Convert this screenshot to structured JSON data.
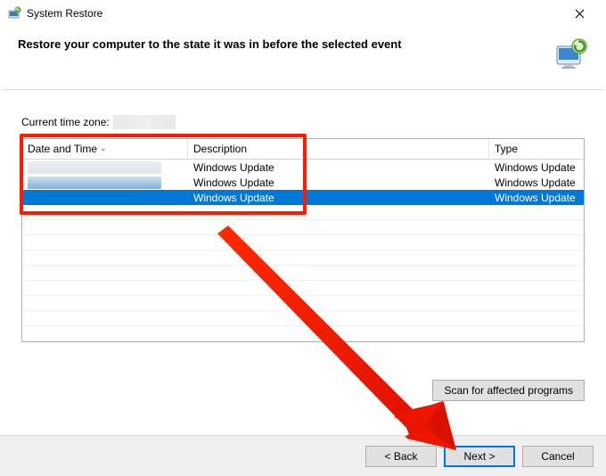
{
  "window": {
    "title": "System Restore"
  },
  "header": {
    "text": "Restore your computer to the state it was in before the selected event"
  },
  "timezone": {
    "label": "Current time zone:"
  },
  "table": {
    "columns": {
      "date_time": "Date and Time",
      "description": "Description",
      "type": "Type"
    },
    "rows": [
      {
        "description": "Windows Update",
        "type": "Windows Update",
        "selected": false
      },
      {
        "description": "Windows Update",
        "type": "Windows Update",
        "selected": false
      },
      {
        "description": "Windows Update",
        "type": "Windows Update",
        "selected": true
      }
    ]
  },
  "buttons": {
    "scan": "Scan for affected programs",
    "back": "< Back",
    "next": "Next >",
    "cancel": "Cancel"
  }
}
